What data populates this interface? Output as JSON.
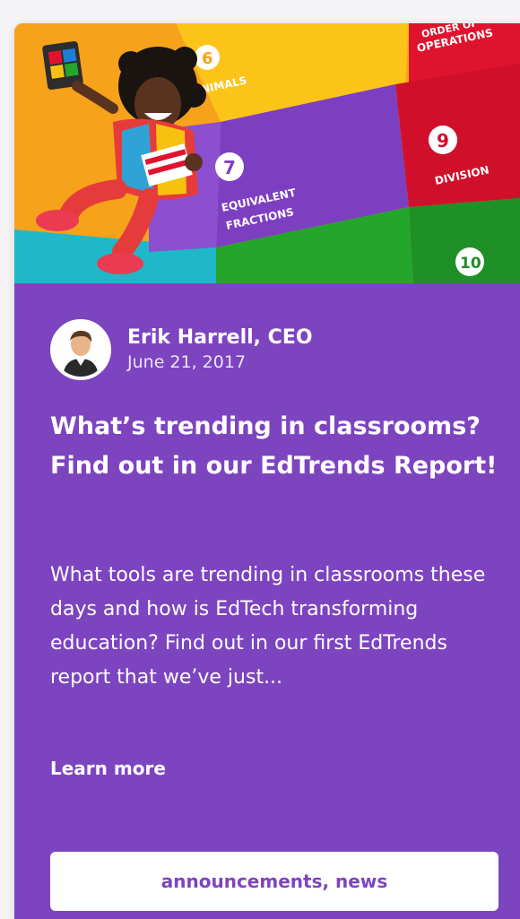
{
  "card": {
    "hero": {
      "tiles": {
        "order_ops_line1": "ORDER OF",
        "order_ops_line2": "OPERATIONS",
        "animals_number": "6",
        "animals": "ANIMALS",
        "fractions_number": "7",
        "fractions_line1": "EQUIVALENT",
        "fractions_line2": "FRACTIONS",
        "division_number": "9",
        "division": "DIVISION",
        "tile_10_number": "10"
      }
    },
    "author": {
      "name": "Erik Harrell, CEO",
      "date": "June 21, 2017"
    },
    "title": "What’s trending in classrooms? Find out in our EdTrends Report!",
    "excerpt": "What tools are trending in classrooms these days and how is EdTech transforming education? Find out in our first EdTrends report that we’ve just...",
    "learn_more": "Learn more",
    "tags": "announcements, news"
  },
  "colors": {
    "card_purple": "#7d44c0",
    "tile_orange": "#f7a21b",
    "tile_yellow": "#fcc419",
    "tile_red": "#e0132f",
    "tile_purple": "#7d3fc1",
    "tile_green": "#24a52c",
    "tile_teal": "#20b8c8"
  },
  "icons": {
    "avatar": "person-avatar",
    "hero": "student-illustration"
  }
}
